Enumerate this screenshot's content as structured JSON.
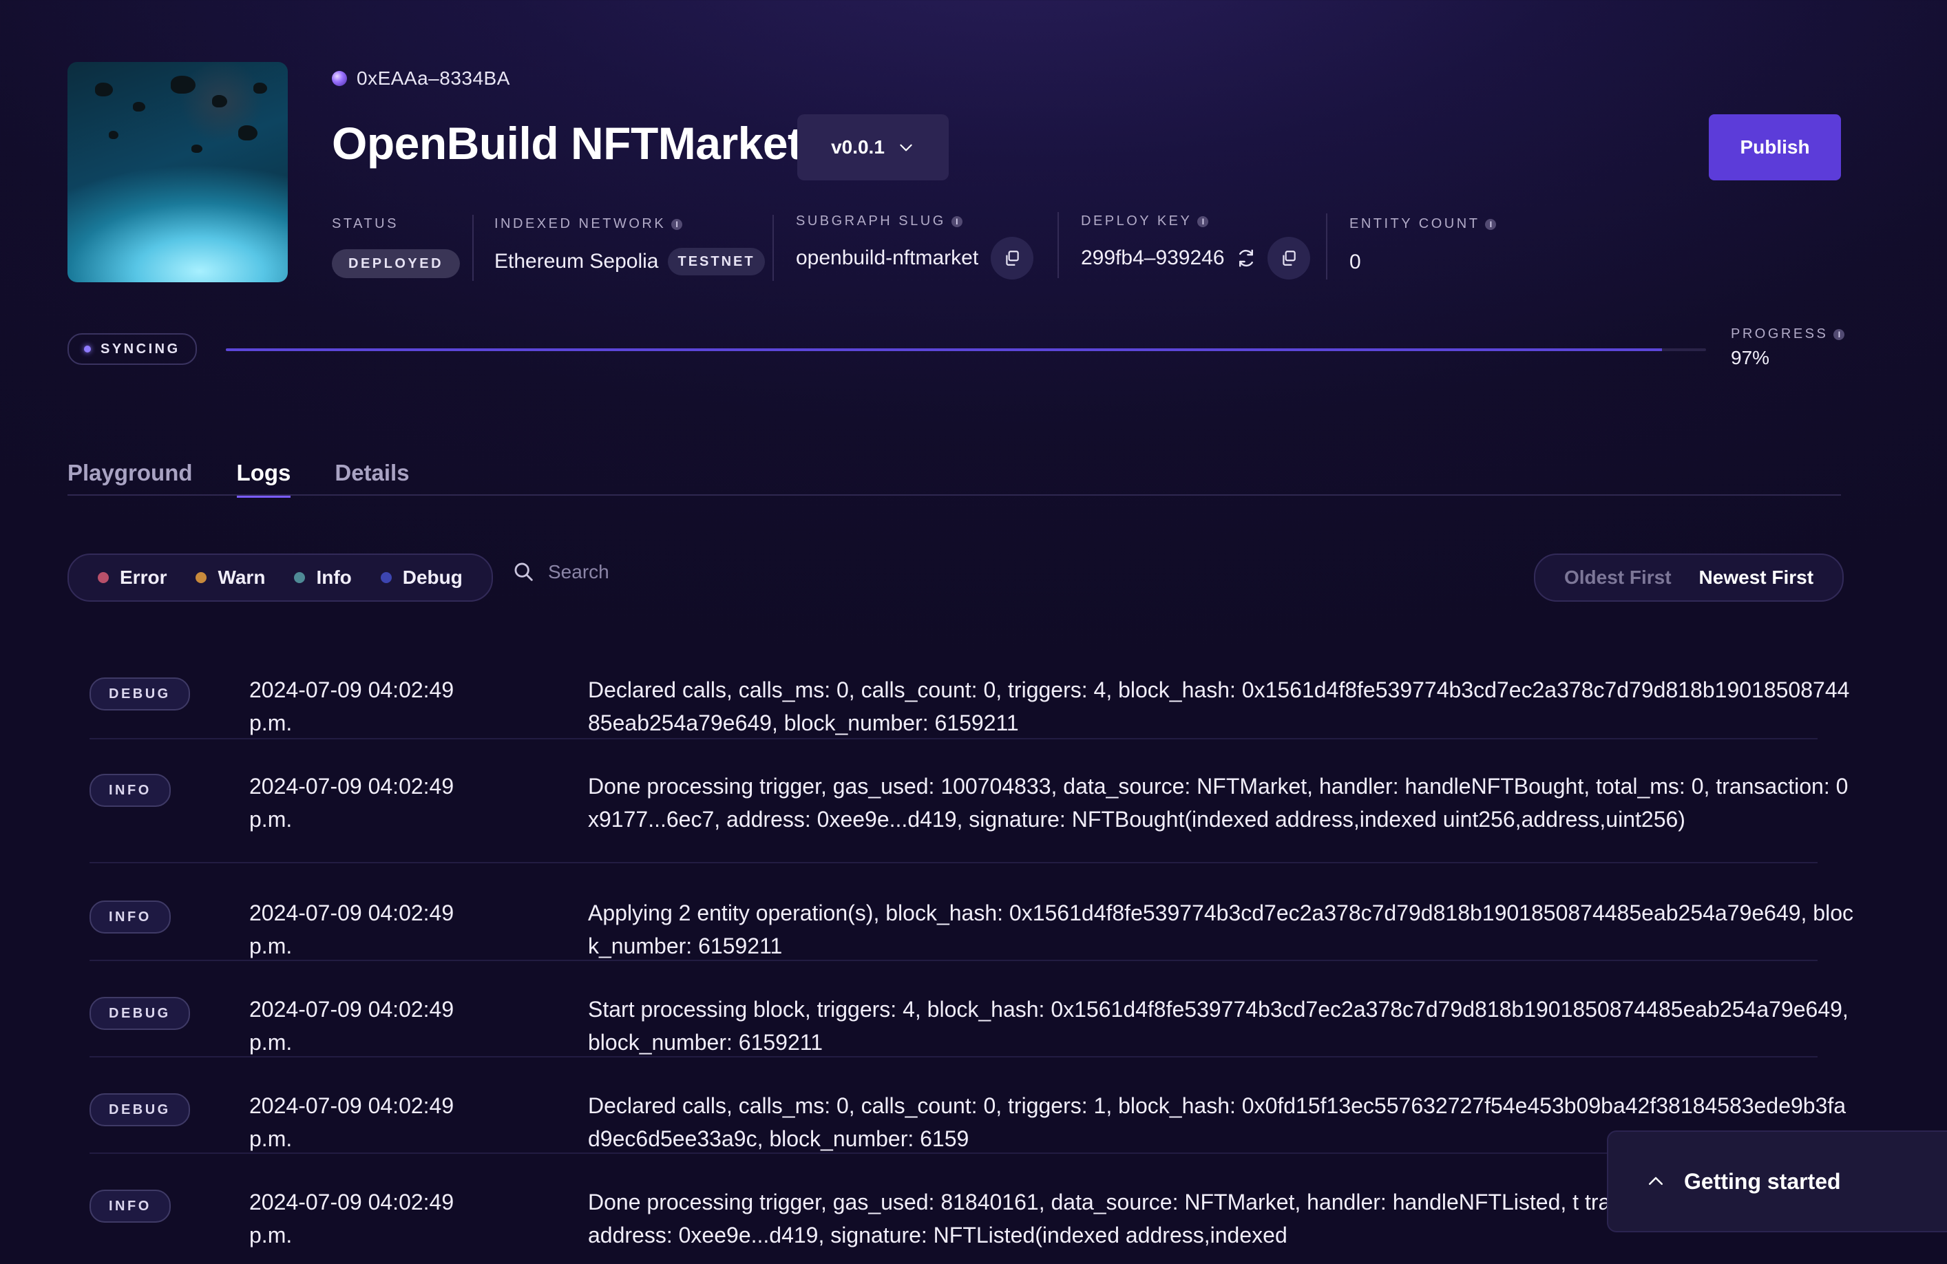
{
  "header": {
    "address": "0xEAAa–8334BA",
    "title": "OpenBuild NFTMarket",
    "version": "v0.0.1",
    "publish_label": "Publish"
  },
  "meta": {
    "status": {
      "label": "STATUS",
      "value": "DEPLOYED"
    },
    "network": {
      "label": "INDEXED NETWORK",
      "value": "Ethereum Sepolia",
      "badge": "TESTNET"
    },
    "slug": {
      "label": "SUBGRAPH SLUG",
      "value": "openbuild-nftmarket"
    },
    "deploy_key": {
      "label": "DEPLOY KEY",
      "value": "299fb4–939246"
    },
    "entity_count": {
      "label": "ENTITY COUNT",
      "value": "0"
    }
  },
  "sync": {
    "status": "SYNCING",
    "progress_label": "PROGRESS",
    "progress_value": "97%",
    "progress_fraction": 0.97
  },
  "tabs": [
    {
      "label": "Playground",
      "active": false
    },
    {
      "label": "Logs",
      "active": true
    },
    {
      "label": "Details",
      "active": false
    }
  ],
  "filters": [
    {
      "label": "Error",
      "color": "#b8506a"
    },
    {
      "label": "Warn",
      "color": "#c88a3c"
    },
    {
      "label": "Info",
      "color": "#4f8a96"
    },
    {
      "label": "Debug",
      "color": "#3d45b0"
    }
  ],
  "search": {
    "placeholder": "Search"
  },
  "sort": {
    "oldest": "Oldest First",
    "newest": "Newest First",
    "selected": "newest"
  },
  "logs": [
    {
      "level": "DEBUG",
      "time_line1": "2024-07-09 04:02:49",
      "time_line2": "p.m.",
      "message": "Declared calls, calls_ms: 0, calls_count: 0, triggers: 4, block_hash: 0x1561d4f8fe539774b3cd7ec2a378c7d79d818b1901850874485eab254a79e649, block_number: 6159211"
    },
    {
      "level": "INFO",
      "time_line1": "2024-07-09 04:02:49",
      "time_line2": "p.m.",
      "message": "Done processing trigger, gas_used: 100704833, data_source: NFTMarket, handler: handleNFTBought, total_ms: 0, transaction: 0x9177...6ec7, address: 0xee9e...d419, signature: NFTBought(indexed address,indexed uint256,address,uint256)"
    },
    {
      "level": "INFO",
      "time_line1": "2024-07-09 04:02:49",
      "time_line2": "p.m.",
      "message": "Applying 2 entity operation(s), block_hash: 0x1561d4f8fe539774b3cd7ec2a378c7d79d818b1901850874485eab254a79e649, block_number: 6159211"
    },
    {
      "level": "DEBUG",
      "time_line1": "2024-07-09 04:02:49",
      "time_line2": "p.m.",
      "message": "Start processing block, triggers: 4, block_hash: 0x1561d4f8fe539774b3cd7ec2a378c7d79d818b1901850874485eab254a79e649, block_number: 6159211"
    },
    {
      "level": "DEBUG",
      "time_line1": "2024-07-09 04:02:49",
      "time_line2": "p.m.",
      "message": "Declared calls, calls_ms: 0, calls_count: 0, triggers: 1, block_hash: 0x0fd15f13ec557632727f54e453b09ba42f38184583ede9b3fad9ec6d5ee33a9c, block_number: 6159"
    },
    {
      "level": "INFO",
      "time_line1": "2024-07-09 04:02:49",
      "time_line2": "p.m.",
      "message": "Done processing trigger, gas_used: 81840161, data_source: NFTMarket, handler: handleNFTListed, t transaction: 0xa441...92bf, address: 0xee9e...d419, signature: NFTListed(indexed address,indexed"
    }
  ],
  "getting_started": {
    "label": "Getting started"
  }
}
